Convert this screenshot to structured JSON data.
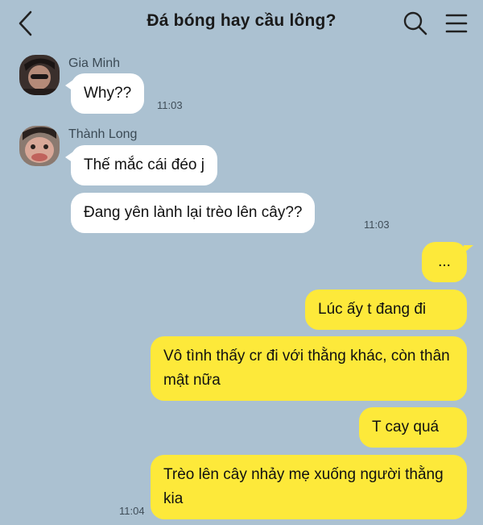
{
  "header": {
    "title": "Đá bóng hay cầu lông?",
    "back_icon": "chevron-left-icon",
    "search_icon": "search-icon",
    "menu_icon": "hamburger-menu-icon"
  },
  "messages": [
    {
      "sender": "Gia Minh",
      "text": "Why??",
      "time": "11:03"
    },
    {
      "sender": "Thành Long",
      "text": "Thế mắc cái đéo j"
    },
    {
      "sender": "Thành Long",
      "text": "Đang yên lành lại trèo lên cây??",
      "time": "11:03"
    },
    {
      "sender": "me",
      "text": "..."
    },
    {
      "sender": "me",
      "text": "Lúc ấy t đang đi"
    },
    {
      "sender": "me",
      "text": "Vô tình thấy cr đi với thằng khác, còn thân mật nữa"
    },
    {
      "sender": "me",
      "text": "T cay quá"
    },
    {
      "sender": "me",
      "text": "Trèo lên cây nhảy mẹ xuống người thằng kia",
      "time": "11:04"
    }
  ],
  "colors": {
    "background": "#abc1d1",
    "incoming_bubble": "#ffffff",
    "outgoing_bubble": "#fde93a"
  }
}
